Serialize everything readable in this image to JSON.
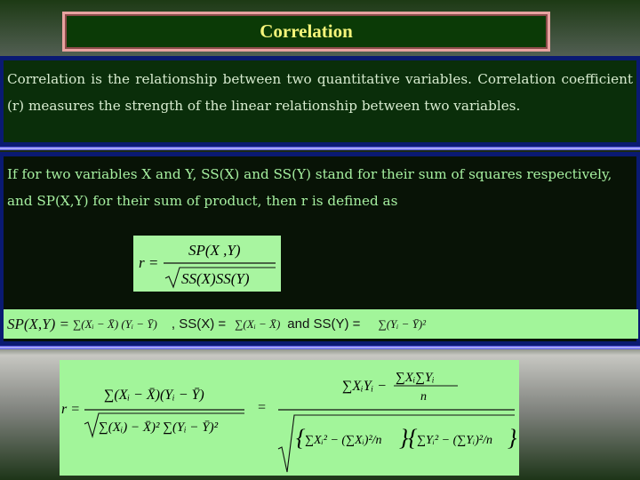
{
  "slide": {
    "title": "Correlation",
    "definition_paragraph": "Correlation is the relationship between two quantitative variables. Correlation coefficient (r) measures the strength of the linear relationship between two variables.",
    "formula_intro": "If for two variables X and Y, SS(X) and SS(Y) stand for their sum of squares respectively, and SP(X,Y) for their sum of product, then r is defined as",
    "basic_formula": {
      "lhs": "r =",
      "numerator": "SP(X ,Y)",
      "denominator": "SS(X)SS(Y)"
    },
    "definitions": {
      "sp_label": "SP(X,Y) =",
      "sp_expr": "∑(Xᵢ − X̄) (Yᵢ − Ȳ)",
      "ssx_label": ", SS(X) =",
      "ssx_expr": "∑(Xᵢ − X̄)",
      "ssy_label": "and SS(Y) =",
      "ssy_expr": "∑(Yᵢ − Ȳ)²"
    },
    "expanded_formula": {
      "lhs": "r =",
      "numerator": "∑(Xᵢ − X̄)(Yᵢ − Ȳ)",
      "denominator": "∑(Xᵢ) − X̄)² ∑(Yᵢ − Ȳ)²",
      "equals": "=",
      "computational_numerator_main": "∑XᵢYᵢ −",
      "computational_numerator_frac_top": "∑Xᵢ∑Yᵢ",
      "n": "n",
      "computational_denominator_x": "∑Xᵢ² − (∑Xᵢ)²/n",
      "computational_denominator_y": "∑Yᵢ² − (∑Yᵢ)²/n"
    }
  },
  "colors": {
    "title_text": "#f5f57a",
    "title_frame": "#e8a3a0",
    "panel_border": "#0a1a72",
    "formula_bg": "#a2f59a",
    "intro_text": "#a6f0a0",
    "definition_text": "#d8ecd0"
  }
}
